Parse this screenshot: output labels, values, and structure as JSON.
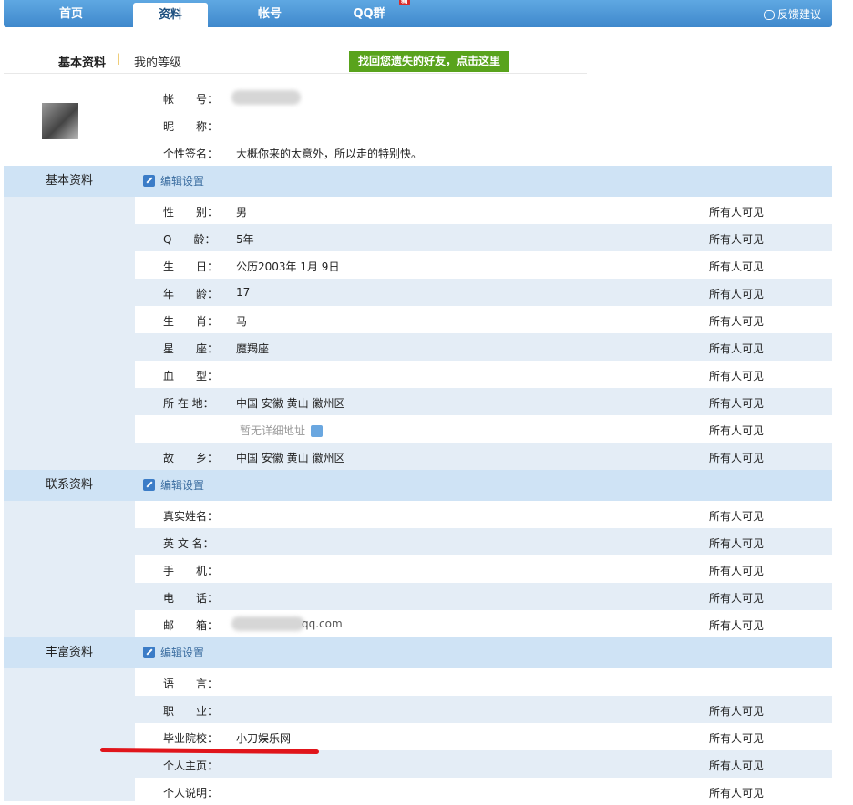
{
  "nav": {
    "tabs": [
      {
        "label": "首页"
      },
      {
        "label": "资料"
      },
      {
        "label": "帐号"
      },
      {
        "label": "QQ群"
      }
    ],
    "new_badge": "新",
    "feedback": "反馈建议"
  },
  "subnav": {
    "basic": "基本资料",
    "sep": "|",
    "level": "我的等级"
  },
  "find_friends": "找回您遗失的好友，点击这里",
  "profile": {
    "account_label": "帐　　号：",
    "nickname_label": "昵　　称：",
    "signature_label": "个性签名：",
    "signature": "大概你来的太意外，所以走的特别快。"
  },
  "edit_label": "编辑设置",
  "sections": {
    "basic": {
      "title": "基本资料",
      "rows": [
        {
          "label": "性　　别：",
          "value": "男",
          "visibility": "所有人可见"
        },
        {
          "label": "Q　　龄：",
          "value": "5年",
          "visibility": "所有人可见"
        },
        {
          "label": "生　　日：",
          "value": "公历2003年 1月 9日",
          "visibility": "所有人可见"
        },
        {
          "label": "年　　龄：",
          "value": "17",
          "visibility": "所有人可见"
        },
        {
          "label": "生　　肖：",
          "value": "马",
          "visibility": "所有人可见"
        },
        {
          "label": "星　　座：",
          "value": "魔羯座",
          "visibility": "所有人可见"
        },
        {
          "label": "血　　型：",
          "value": "",
          "visibility": "所有人可见"
        },
        {
          "label": "所 在 地：",
          "value": "中国  安徽  黄山  徽州区",
          "visibility": "所有人可见"
        },
        {
          "label": "",
          "value": "暂无详细地址",
          "visibility": "所有人可见"
        },
        {
          "label": "故　　乡：",
          "value": "中国  安徽  黄山  徽州区",
          "visibility": "所有人可见"
        }
      ]
    },
    "contact": {
      "title": "联系资料",
      "rows": [
        {
          "label": "真实姓名：",
          "value": "",
          "visibility": "所有人可见"
        },
        {
          "label": "英 文 名：",
          "value": "",
          "visibility": "所有人可见"
        },
        {
          "label": "手　　机：",
          "value": "",
          "visibility": "所有人可见"
        },
        {
          "label": "电　　话：",
          "value": "",
          "visibility": "所有人可见"
        },
        {
          "label": "邮　　箱：",
          "value": "qq.com",
          "visibility": "所有人可见"
        }
      ]
    },
    "rich": {
      "title": "丰富资料",
      "rows": [
        {
          "label": "语　　言：",
          "value": "",
          "visibility": ""
        },
        {
          "label": "职　　业：",
          "value": "",
          "visibility": "所有人可见"
        },
        {
          "label": "毕业院校：",
          "value": "小刀娱乐网",
          "visibility": "所有人可见"
        },
        {
          "label": "个人主页：",
          "value": "",
          "visibility": "所有人可见"
        },
        {
          "label": "个人说明：",
          "value": "",
          "visibility": "所有人可见"
        }
      ]
    }
  },
  "colors": {
    "nav": "#4a95d8",
    "section": "#cfe3f5",
    "alt_row": "#e4edf6",
    "find_btn": "#59a31c",
    "annotation": "#e0151b"
  }
}
